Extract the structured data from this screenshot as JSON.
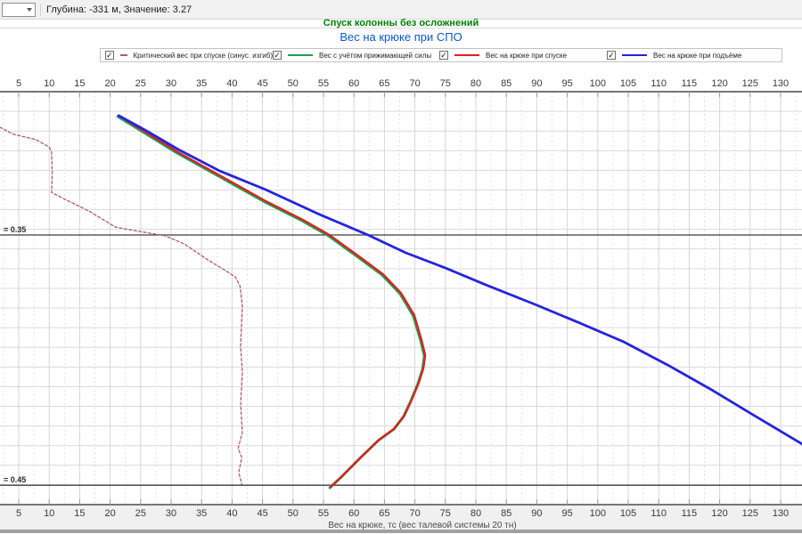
{
  "toolbar": {
    "combo_value": "",
    "status": "Глубина: -331 м, Значение: 3.27"
  },
  "header": {
    "title": "Спуск колонны без осложнений",
    "title_color": "#008000",
    "subtitle": "Вес на крюке при СПО",
    "subtitle_color": "#0a58ca"
  },
  "legend": {
    "items": [
      {
        "label": "Критический вес при спуске (синус. изгиб)",
        "checked": true,
        "color": "#b5537a",
        "style": "dashed"
      },
      {
        "label": "Вес с учётом прижимающей силы",
        "checked": true,
        "color": "#1e9e50",
        "style": "solid"
      },
      {
        "label": "Вес на крюке при спуске",
        "checked": true,
        "color": "#e31e1e",
        "style": "solid"
      },
      {
        "label": "Вес на крюке при подъёме",
        "checked": true,
        "color": "#2424dd",
        "style": "solid"
      }
    ],
    "check_glyph": "✓"
  },
  "chart_data": {
    "type": "line",
    "title": "Спуск колонны без осложнений",
    "subtitle": "Вес на крюке при СПО",
    "xlabel": "Вес на крюке, тс (вес талевой системы 20 тн)",
    "ylabel": "",
    "x_axis": {
      "min": 5,
      "max": 130,
      "step": 5,
      "minor_step": 2.5,
      "mirrored": "top and bottom"
    },
    "y_axis": {
      "tick_labels": "none (depth axis, unlabeled)"
    },
    "grid": "on",
    "legend_position": "top, checkbox row",
    "reference_lines": [
      {
        "label": "= 0.35",
        "y_frac": 0.347
      },
      {
        "label": "= 0.45",
        "y_frac": 0.953
      }
    ],
    "series": [
      {
        "name": "Критический вес при спуске (синус. изгиб)",
        "color": "#b5537a",
        "style": "dashed",
        "width": 1.3,
        "points": [
          [
            1.9,
            0.086
          ],
          [
            4.1,
            0.103
          ],
          [
            7.8,
            0.116
          ],
          [
            10.0,
            0.134
          ],
          [
            10.4,
            0.147
          ],
          [
            10.5,
            0.2
          ],
          [
            10.4,
            0.244
          ],
          [
            12.9,
            0.263
          ],
          [
            16.5,
            0.289
          ],
          [
            20.9,
            0.328
          ],
          [
            24.6,
            0.338
          ],
          [
            29.0,
            0.349
          ],
          [
            32.2,
            0.369
          ],
          [
            36.0,
            0.407
          ],
          [
            38.9,
            0.433
          ],
          [
            40.5,
            0.448
          ],
          [
            41.3,
            0.47
          ],
          [
            41.7,
            0.519
          ],
          [
            41.4,
            0.616
          ],
          [
            41.7,
            0.681
          ],
          [
            41.4,
            0.757
          ],
          [
            41.7,
            0.825
          ],
          [
            41.0,
            0.864
          ],
          [
            41.6,
            0.886
          ],
          [
            41.1,
            0.922
          ],
          [
            41.6,
            0.95
          ]
        ]
      },
      {
        "name": "Вес с учётом прижимающей силы",
        "color": "#1e9e50",
        "style": "solid",
        "width": 3.0,
        "offset": [
          -1,
          1
        ],
        "points": [
          [
            21.4,
            0.058
          ],
          [
            31.2,
            0.147
          ],
          [
            38.5,
            0.207
          ],
          [
            45.8,
            0.267
          ],
          [
            51.6,
            0.31
          ],
          [
            56.0,
            0.347
          ],
          [
            60.4,
            0.394
          ],
          [
            64.8,
            0.442
          ],
          [
            67.7,
            0.487
          ],
          [
            69.9,
            0.541
          ],
          [
            71.1,
            0.601
          ],
          [
            71.7,
            0.638
          ],
          [
            71.4,
            0.67
          ],
          [
            70.6,
            0.707
          ],
          [
            69.5,
            0.746
          ],
          [
            68.3,
            0.784
          ],
          [
            66.7,
            0.815
          ],
          [
            64.1,
            0.843
          ],
          [
            61.1,
            0.886
          ],
          [
            58.2,
            0.929
          ],
          [
            56.2,
            0.957
          ]
        ]
      },
      {
        "name": "Вес на крюке при спуске",
        "color": "#e31e1e",
        "style": "solid",
        "width": 2.2,
        "points": [
          [
            21.4,
            0.058
          ],
          [
            31.2,
            0.147
          ],
          [
            38.5,
            0.207
          ],
          [
            45.8,
            0.267
          ],
          [
            51.6,
            0.31
          ],
          [
            56.0,
            0.347
          ],
          [
            60.4,
            0.394
          ],
          [
            64.8,
            0.442
          ],
          [
            67.7,
            0.487
          ],
          [
            69.9,
            0.541
          ],
          [
            71.1,
            0.601
          ],
          [
            71.7,
            0.638
          ],
          [
            71.4,
            0.67
          ],
          [
            70.6,
            0.707
          ],
          [
            69.5,
            0.746
          ],
          [
            68.3,
            0.784
          ],
          [
            66.7,
            0.815
          ],
          [
            64.1,
            0.843
          ],
          [
            61.1,
            0.886
          ],
          [
            58.2,
            0.929
          ],
          [
            56.2,
            0.957
          ]
        ]
      },
      {
        "name": "Вес на крюке при подъёме",
        "color": "#2424dd",
        "style": "solid",
        "width": 2.8,
        "points": [
          [
            21.4,
            0.058
          ],
          [
            26.0,
            0.095
          ],
          [
            31.2,
            0.14
          ],
          [
            38.0,
            0.192
          ],
          [
            45.5,
            0.237
          ],
          [
            54.0,
            0.295
          ],
          [
            62.3,
            0.347
          ],
          [
            68.5,
            0.39
          ],
          [
            75.0,
            0.427
          ],
          [
            82.0,
            0.47
          ],
          [
            89.7,
            0.515
          ],
          [
            97.0,
            0.56
          ],
          [
            104.3,
            0.606
          ],
          [
            111.5,
            0.662
          ],
          [
            118.9,
            0.724
          ],
          [
            126.0,
            0.787
          ],
          [
            133.5,
            0.853
          ]
        ]
      }
    ]
  }
}
